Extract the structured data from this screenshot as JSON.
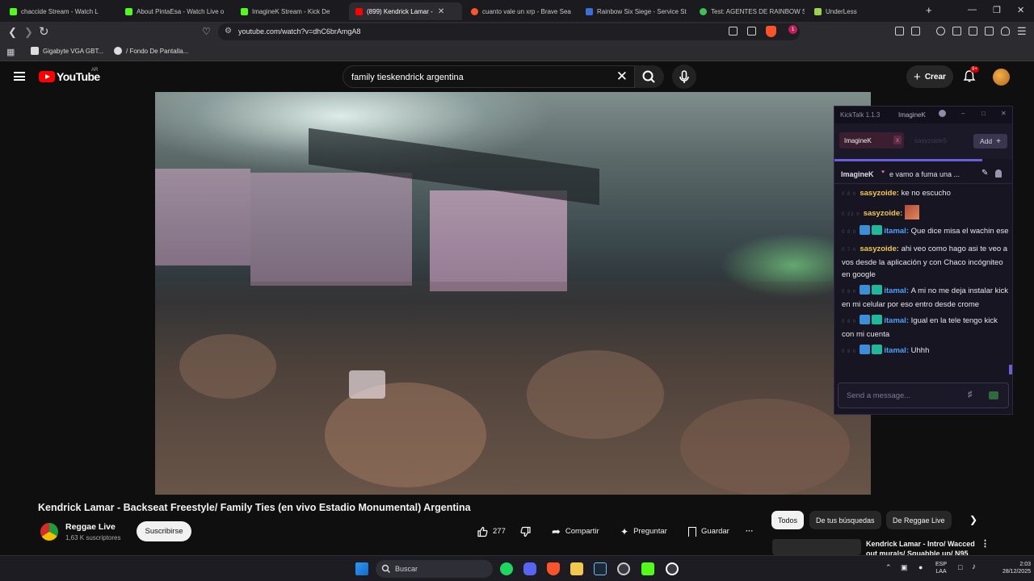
{
  "browser": {
    "tabs": [
      {
        "title": "chaccide Stream - Watch L",
        "color": "#53fc18"
      },
      {
        "title": "About PintaEsa - Watch Live o",
        "color": "#53fc18"
      },
      {
        "title": "ImagineK Stream - Kick De",
        "color": "#53fc18"
      },
      {
        "title": "(899) Kendrick Lamar -",
        "color": "#ff0000",
        "close": "✕"
      },
      {
        "title": "cuanto vale un xrp - Brave Sea",
        "color": "#fb542b"
      },
      {
        "title": "Rainbow Six Siege - Service St",
        "color": "#3a6fd8"
      },
      {
        "title": "Test: AGENTES DE RAINBOW S",
        "color": "#3fbf5a"
      },
      {
        "title": "UnderLess",
        "color": "#9bd34a"
      }
    ],
    "new_tab": "+",
    "url": "youtube.com/watch?v=dhC6brAmgA8",
    "shield_badge": "1",
    "bookmarks": [
      "Gigabyte VGA GBT...",
      "/ Fondo De Pantalla..."
    ]
  },
  "youtube": {
    "logo_text": "YouTube",
    "country": "AR",
    "search_value": "family tieskendrick argentina",
    "create_label": "Crear",
    "notifications": "9+"
  },
  "kicktalk": {
    "app_title": "KickTalk 1.1.3",
    "window_channel": "ImagineK",
    "tabs": [
      {
        "label": "ImagineK",
        "close": "x"
      },
      {
        "label": "sasyzoide5"
      }
    ],
    "add_label": "Add",
    "pinned": {
      "user": "ImagineK",
      "text": "e vamo a fuma una ..."
    },
    "messages": [
      {
        "meta": "0 8 h",
        "user": "sasyzoide",
        "color": "#f2c94c",
        "badges": 0,
        "text": "ke no escucho",
        "emote": false
      },
      {
        "meta": "0 22 h",
        "user": "sasyzoide",
        "color": "#f2c94c",
        "badges": 0,
        "text": "",
        "emote": true
      },
      {
        "meta": "0 8 h",
        "user": "itamal",
        "color": "#4aa3ff",
        "badges": 2,
        "text": "Que dice misa el wachin ese",
        "emote": false
      },
      {
        "meta": "0 7 h",
        "user": "sasyzoide",
        "color": "#f2c94c",
        "badges": 0,
        "text": "ahi veo como hago asi te veo a vos desde la aplicación y con Chaco incógniteo en google",
        "emote": false
      },
      {
        "meta": "0 8 h",
        "user": "itamal",
        "color": "#4aa3ff",
        "badges": 2,
        "text": "A mi no me deja instalar kick en mi celular por eso entro desde crome",
        "emote": false
      },
      {
        "meta": "0 8 h",
        "user": "itamal",
        "color": "#4aa3ff",
        "badges": 2,
        "text": "Igual en la tele tengo kick con mi cuenta",
        "emote": false
      },
      {
        "meta": "0 8 h",
        "user": "itamal",
        "color": "#4aa3ff",
        "badges": 2,
        "text": "Uhhh",
        "emote": false
      }
    ],
    "input_placeholder": "Send a message..."
  },
  "video": {
    "title": "Kendrick Lamar - Backseat Freestyle/ Family Ties (en vivo Estadio Monumental) Argentina",
    "channel": "Reggae Live",
    "subscribers": "1,63 K suscriptores",
    "subscribe_label": "Suscribirse",
    "likes": "277",
    "share_label": "Compartir",
    "ask_label": "Preguntar",
    "save_label": "Guardar",
    "more_label": "···"
  },
  "chips": [
    "Todos",
    "De tus búsquedas",
    "De Reggae Live"
  ],
  "recommended": {
    "title": "Kendrick Lamar - Intro/ Wacced out murals/ Squabble up/ N95"
  },
  "taskbar": {
    "search_placeholder": "Buscar",
    "lang_line1": "ESP",
    "lang_line2": "LAA",
    "time": "2:03",
    "date": "28/12/2025"
  }
}
